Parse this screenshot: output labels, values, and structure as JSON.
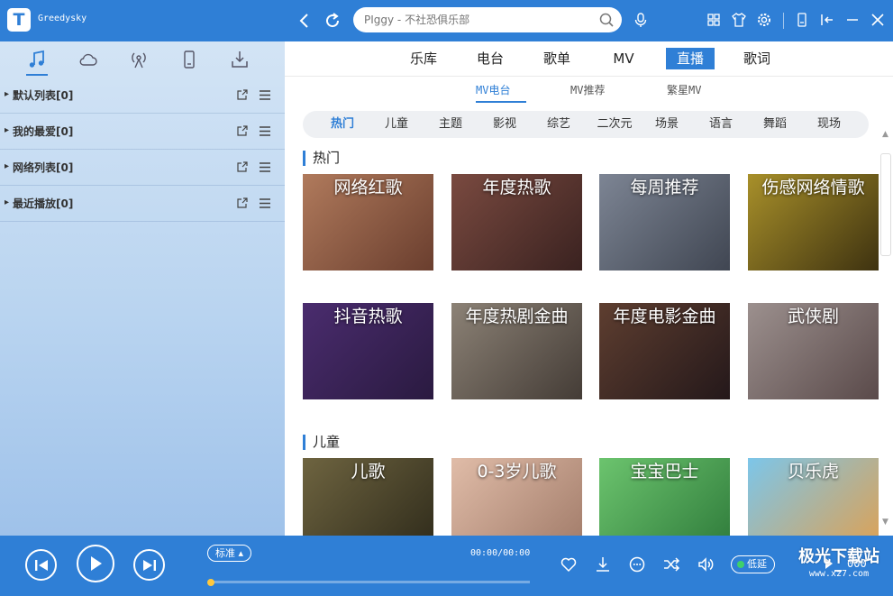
{
  "app": {
    "name": "Greedysky",
    "logo_letter": "T"
  },
  "search": {
    "placeholder": "PIggy - 不社恐俱乐部"
  },
  "playlists": [
    {
      "label": "默认列表[0]"
    },
    {
      "label": "我的最爱[0]"
    },
    {
      "label": "网络列表[0]"
    },
    {
      "label": "最近播放[0]"
    }
  ],
  "main_tabs": [
    {
      "label": "乐库",
      "active": false
    },
    {
      "label": "电台",
      "active": false
    },
    {
      "label": "歌单",
      "active": false
    },
    {
      "label": "MV",
      "active": false
    },
    {
      "label": "直播",
      "active": true
    },
    {
      "label": "歌词",
      "active": false
    }
  ],
  "sub_tabs": [
    {
      "label": "MV电台",
      "active": true
    },
    {
      "label": "MV推荐",
      "active": false
    },
    {
      "label": "繁星MV",
      "active": false
    }
  ],
  "categories": [
    {
      "label": "热门",
      "active": true
    },
    {
      "label": "儿童",
      "active": false
    },
    {
      "label": "主题",
      "active": false
    },
    {
      "label": "影视",
      "active": false
    },
    {
      "label": "综艺",
      "active": false
    },
    {
      "label": "二次元",
      "active": false
    },
    {
      "label": "场景",
      "active": false
    },
    {
      "label": "语言",
      "active": false
    },
    {
      "label": "舞蹈",
      "active": false
    },
    {
      "label": "现场",
      "active": false
    }
  ],
  "sections": [
    {
      "title": "热门",
      "cards": [
        {
          "label": "网络红歌",
          "bg": "#8f5a44"
        },
        {
          "label": "年度热歌",
          "bg": "#5c3a36"
        },
        {
          "label": "每周推荐",
          "bg": "#5d6473"
        },
        {
          "label": "伤感网络情歌",
          "bg": "#6a5a1c"
        },
        {
          "label": "抖音热歌",
          "bg": "#3b2456"
        },
        {
          "label": "年度热剧金曲",
          "bg": "#6a625a"
        },
        {
          "label": "年度电影金曲",
          "bg": "#3e2e2a"
        },
        {
          "label": "武侠剧",
          "bg": "#7a6e6c"
        }
      ]
    },
    {
      "title": "儿童",
      "cards": [
        {
          "label": "儿歌",
          "bg": "#4e4a34"
        },
        {
          "label": "0-3岁儿歌",
          "bg": "#c9a592"
        },
        {
          "label": "宝宝巴士",
          "bg": "#4aa55a"
        },
        {
          "label": "贝乐虎",
          "bg": "#5aa8d6"
        }
      ]
    }
  ],
  "player": {
    "quality": "标准",
    "time": "00:00/00:00",
    "progress_percent": 0,
    "low_latency_label": "低延",
    "tail_text": "000"
  },
  "watermark": {
    "line1": "极光下载站",
    "line2": "www.xz7.com"
  },
  "colors": {
    "accent": "#2f7fd6",
    "progress": "#ffc83d"
  }
}
